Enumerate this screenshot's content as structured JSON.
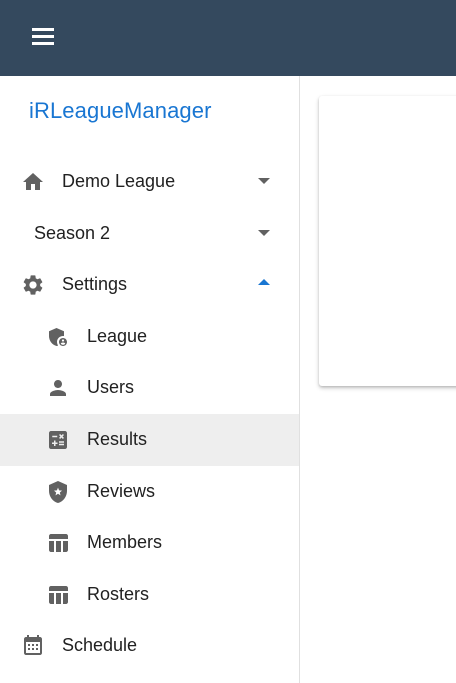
{
  "appbar": {
    "menu_icon": "menu-icon",
    "color": "#34495e"
  },
  "brand": {
    "title": "iRLeagueManager",
    "color": "#1976d2"
  },
  "nav": {
    "league_select": {
      "label": "Demo League",
      "icon": "home-icon"
    },
    "season_select": {
      "label": "Season 2"
    },
    "settings": {
      "label": "Settings",
      "icon": "gear-icon",
      "expanded": true
    },
    "settings_items": [
      {
        "label": "League",
        "icon": "shield-account-icon"
      },
      {
        "label": "Users",
        "icon": "person-icon"
      },
      {
        "label": "Results",
        "icon": "calculator-icon",
        "active": true
      },
      {
        "label": "Reviews",
        "icon": "shield-star-icon"
      },
      {
        "label": "Members",
        "icon": "table-icon"
      },
      {
        "label": "Rosters",
        "icon": "table-icon"
      }
    ],
    "schedule": {
      "label": "Schedule",
      "icon": "calendar-icon"
    }
  }
}
